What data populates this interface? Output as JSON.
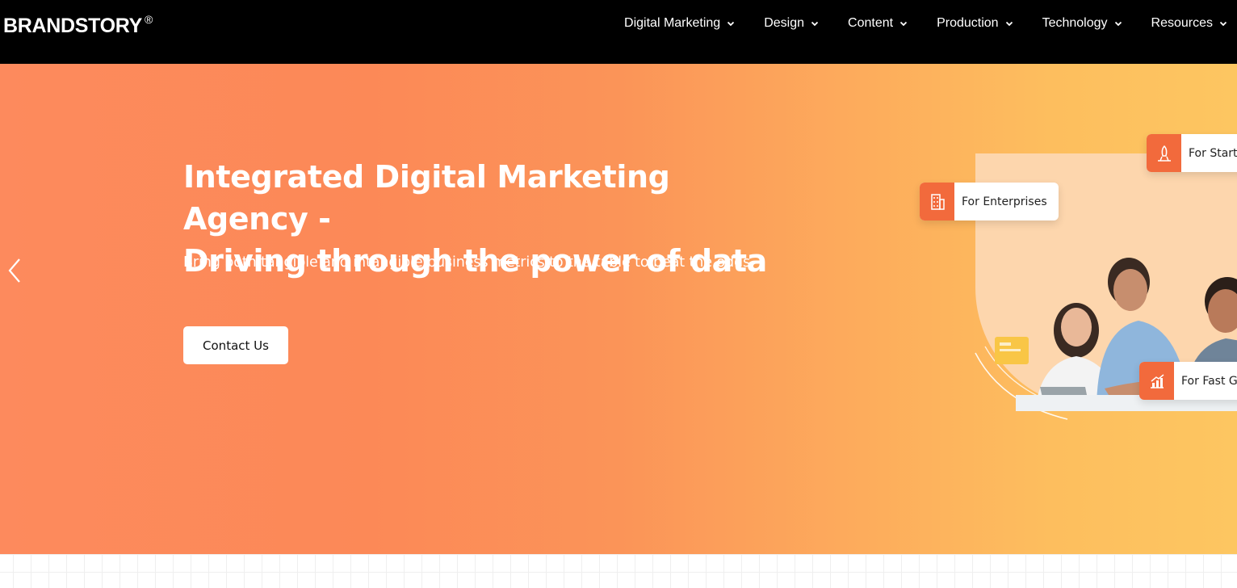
{
  "header": {
    "logo": "BRANDSTORY",
    "logo_mark": "®",
    "nav": [
      {
        "label": "Digital Marketing",
        "icon": "chevron-down-icon"
      },
      {
        "label": "Design",
        "icon": "chevron-down-icon"
      },
      {
        "label": "Content",
        "icon": "chevron-down-icon"
      },
      {
        "label": "Production",
        "icon": "chevron-down-icon"
      },
      {
        "label": "Technology",
        "icon": "chevron-down-icon"
      },
      {
        "label": "Resources",
        "icon": "chevron-down-icon"
      }
    ]
  },
  "hero": {
    "headline_line1": "Integrated Digital Marketing Agency -",
    "headline_line2": "Driving through the power of data",
    "subline": "Bring both tangible and intangible business metrics to the table to beat the odds.",
    "cta_label": "Contact Us",
    "prev_icon": "chevron-left-icon",
    "chips": {
      "enterprises": "For Enterprises",
      "startups": "For Startu",
      "fast_growth": "For Fast Gr"
    }
  },
  "colors": {
    "header_bg": "#000000",
    "hero_gradient_start": "#fd8a5d",
    "hero_gradient_end": "#fdc661",
    "chip_icon_bg": "#f26a3c",
    "cta_bg": "#ffffff"
  }
}
